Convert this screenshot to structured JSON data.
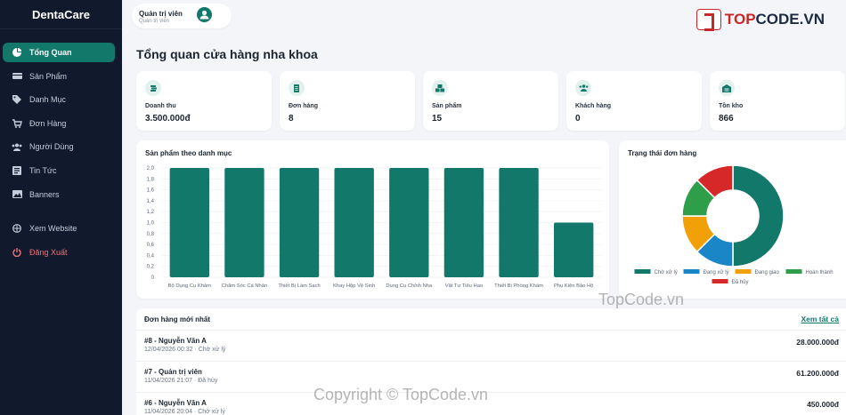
{
  "app": {
    "brand": "DentaCare"
  },
  "sidebar": {
    "items": [
      {
        "label": "Tổng Quan",
        "icon": "pie-chart-icon",
        "active": true
      },
      {
        "label": "Sản Phẩm",
        "icon": "box-icon"
      },
      {
        "label": "Danh Mục",
        "icon": "tags-icon"
      },
      {
        "label": "Đơn Hàng",
        "icon": "cart-icon"
      },
      {
        "label": "Người Dùng",
        "icon": "users-icon"
      },
      {
        "label": "Tin Tức",
        "icon": "newspaper-icon"
      },
      {
        "label": "Banners",
        "icon": "images-icon"
      }
    ],
    "extra": [
      {
        "label": "Xem Website",
        "icon": "globe-icon"
      },
      {
        "label": "Đăng Xuất",
        "icon": "power-icon"
      }
    ]
  },
  "user": {
    "name": "Quản trị viên",
    "role": "Quản trị viên"
  },
  "logo": {
    "part1": "TOP",
    "part2": "CODE.VN"
  },
  "page": {
    "title": "Tổng quan cửa hàng nha khoa"
  },
  "stats": [
    {
      "label": "Doanh thu",
      "value": "3.500.000đ",
      "icon": "money-icon"
    },
    {
      "label": "Đơn hàng",
      "value": "8",
      "icon": "receipt-icon"
    },
    {
      "label": "Sản phẩm",
      "value": "15",
      "icon": "boxes-icon"
    },
    {
      "label": "Khách hàng",
      "value": "0",
      "icon": "users-icon"
    },
    {
      "label": "Tồn kho",
      "value": "866",
      "icon": "warehouse-icon"
    }
  ],
  "bar_card_title": "Sản phẩm theo danh mục",
  "donut_card_title": "Trạng thái đơn hàng",
  "colors": {
    "accent": "#12786a",
    "sidebar": "#101a2c",
    "logout": "#f07179"
  },
  "chart_data": [
    {
      "type": "bar",
      "title": "Sản phẩm theo danh mục",
      "categories": [
        "Bộ Dụng Cụ Khám",
        "Chăm Sóc Cá Nhân",
        "Thiết Bị Làm Sạch",
        "Khay Hộp Vệ Sinh",
        "Dụng Cụ Chỉnh Nha",
        "Vật Tư Tiêu Hao",
        "Thiết Bị Phòng Khám",
        "Phụ Kiện Bảo Hộ"
      ],
      "values": [
        2,
        2,
        2,
        2,
        2,
        2,
        2,
        1
      ],
      "ylim": [
        0,
        2
      ],
      "yticks": [
        "0",
        "0,2",
        "0,4",
        "0,6",
        "0,8",
        "1,0",
        "1,2",
        "1,4",
        "1,6",
        "1,8",
        "2,0"
      ],
      "color": "#12786a",
      "grid": true
    },
    {
      "type": "pie",
      "title": "Trạng thái đơn hàng",
      "labels": [
        "Chờ xử lý",
        "Đang xử lý",
        "Đang giao",
        "Hoàn thành",
        "Đã hủy"
      ],
      "values": [
        4,
        1,
        1,
        1,
        1
      ],
      "colors": [
        "#12786a",
        "#1a86c8",
        "#f2a007",
        "#2e9e4a",
        "#d62828"
      ],
      "legend": "bottom"
    }
  ],
  "orders": {
    "title": "Đơn hàng mới nhất",
    "link": "Xem tất cả",
    "rows": [
      {
        "name": "#8 - Nguyễn Văn A",
        "meta": "12/04/2026 00:32 · Chờ xử lý",
        "total": "28.000.000đ"
      },
      {
        "name": "#7 - Quản trị viên",
        "meta": "11/04/2026 21:07 · Đã hủy",
        "total": "61.200.000đ"
      },
      {
        "name": "#6 - Nguyễn Văn A",
        "meta": "11/04/2026 20:04 · Chờ xử lý",
        "total": "450.000đ"
      }
    ]
  },
  "watermarks": [
    "TopCode.vn",
    "Copyright © TopCode.vn"
  ]
}
